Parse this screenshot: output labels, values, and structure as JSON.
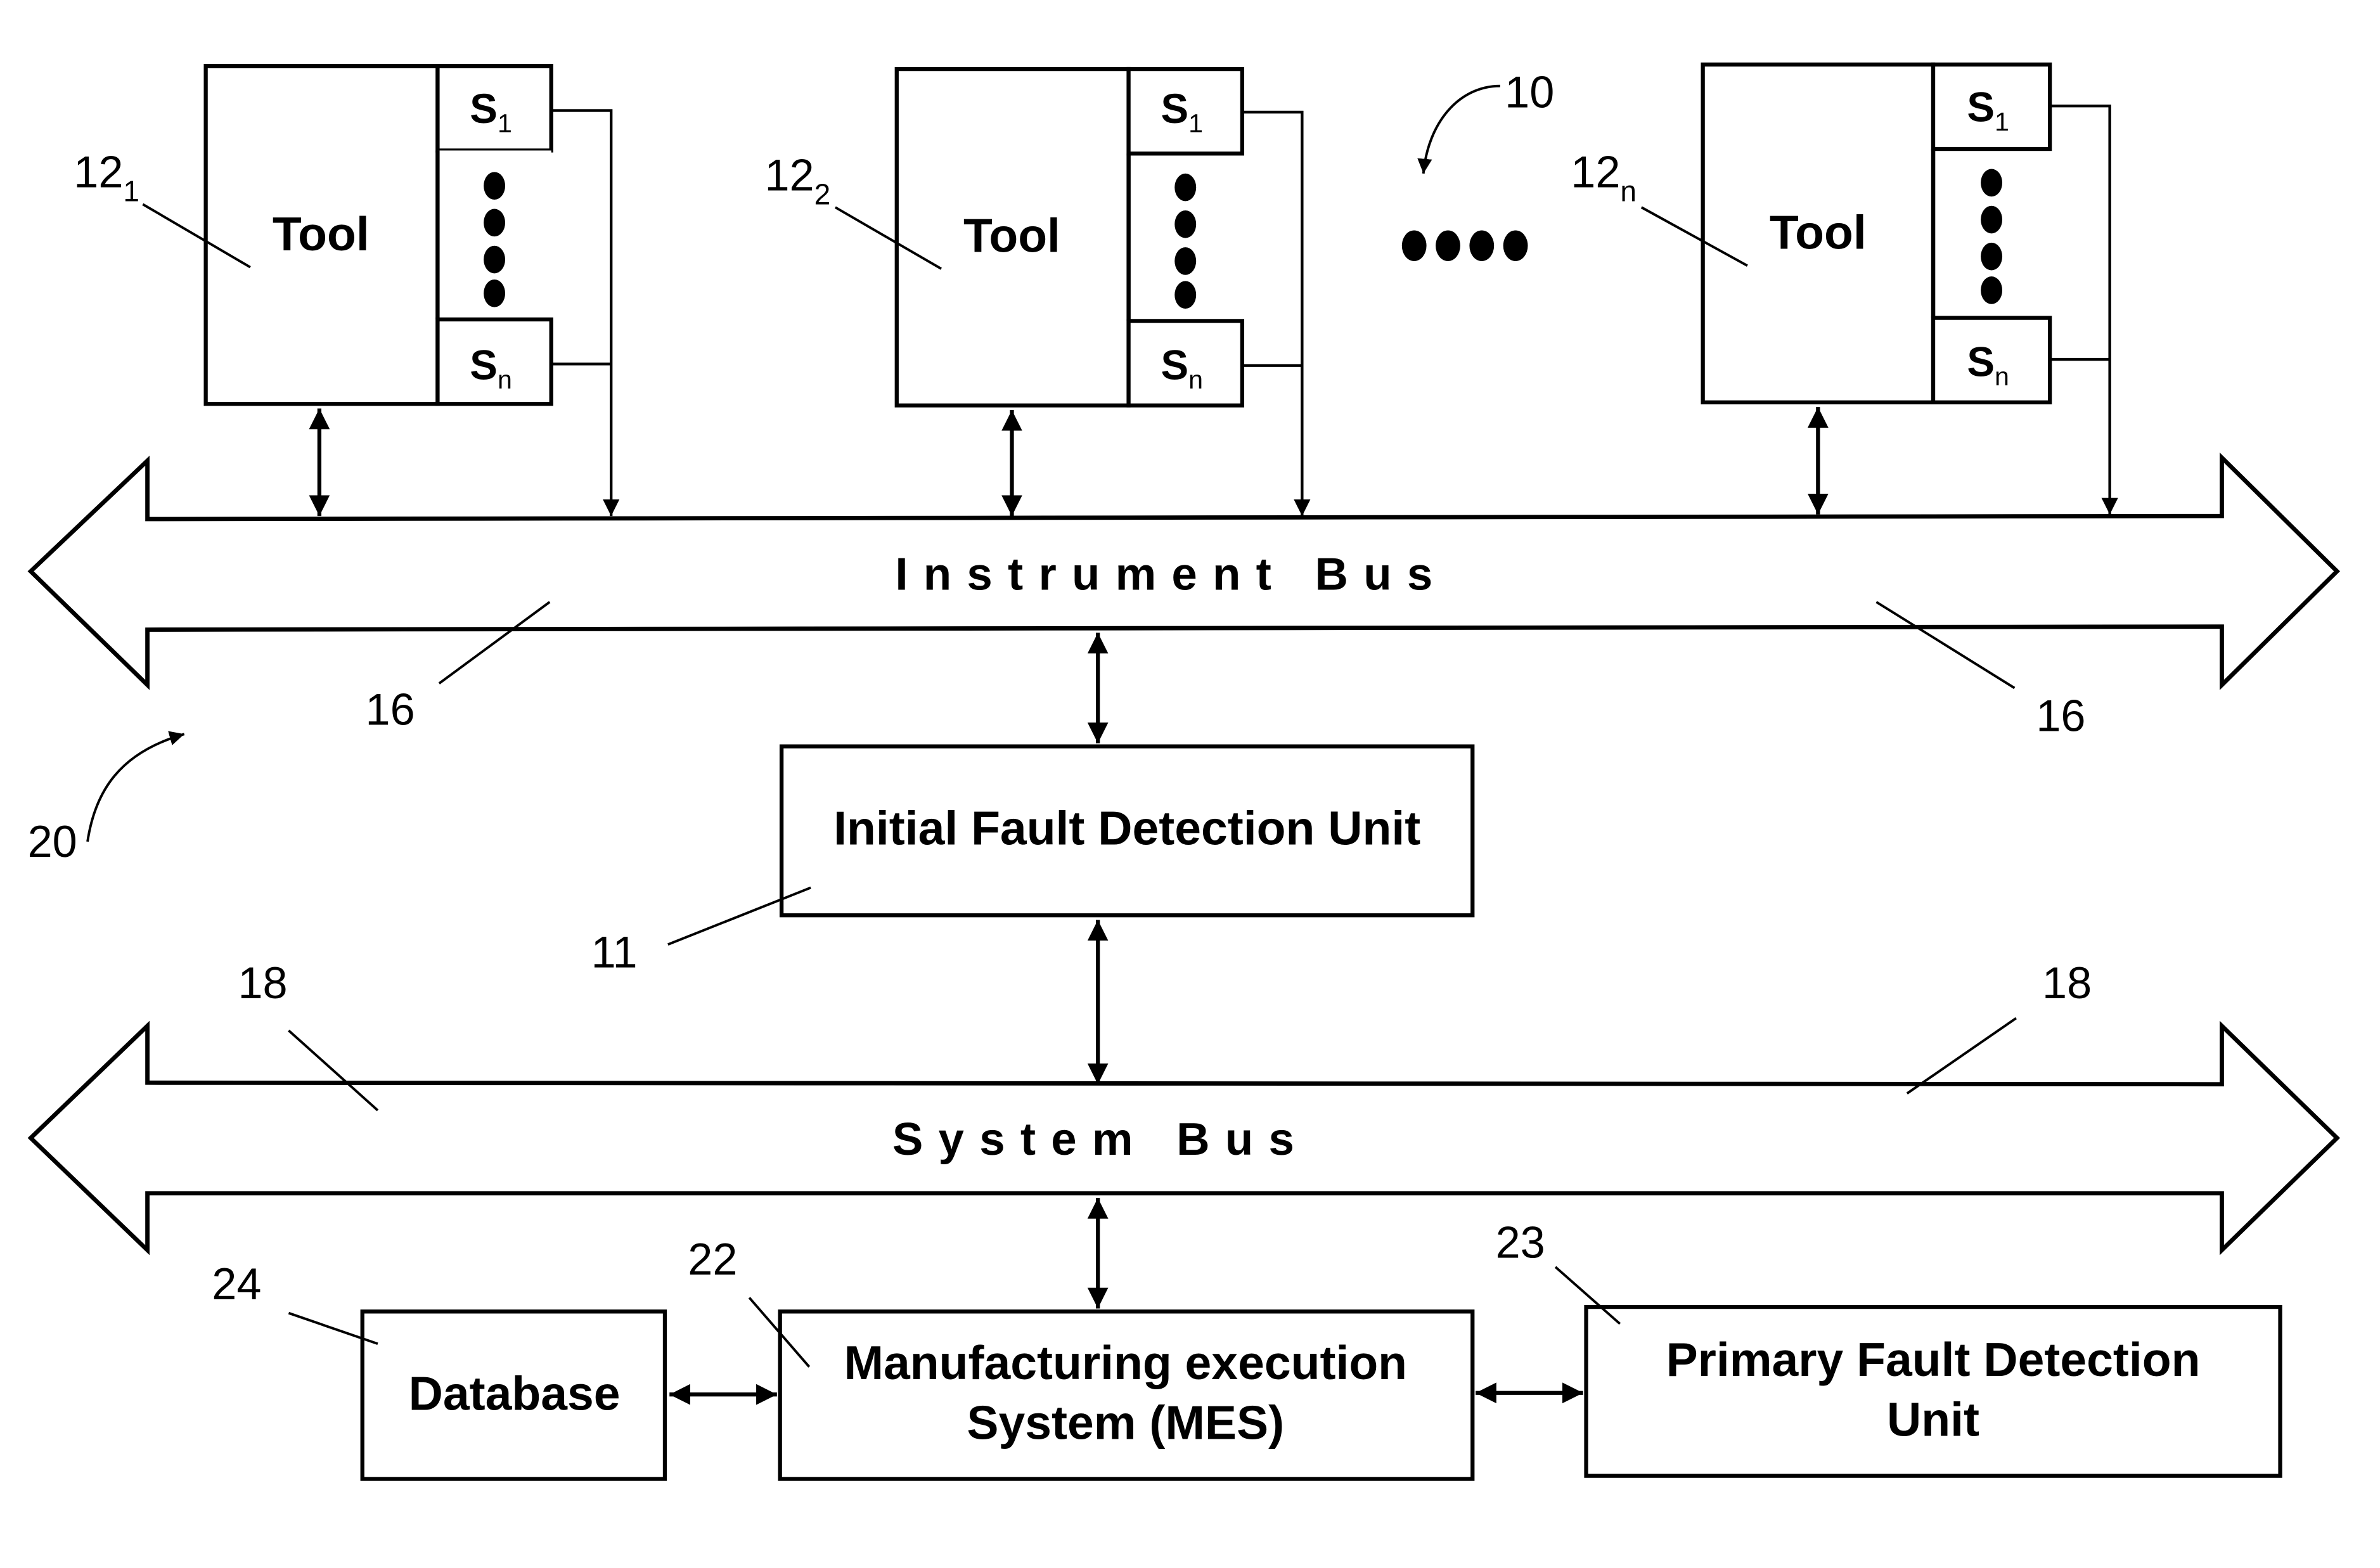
{
  "figure": {
    "system_ref": "10",
    "network_ref": "20"
  },
  "tools": [
    {
      "ref_main": "12",
      "ref_sub": "1",
      "label": "Tool",
      "sensor_first": {
        "main": "S",
        "sub": "1"
      },
      "sensor_last": {
        "main": "S",
        "sub": "n"
      }
    },
    {
      "ref_main": "12",
      "ref_sub": "2",
      "label": "Tool",
      "sensor_first": {
        "main": "S",
        "sub": "1"
      },
      "sensor_last": {
        "main": "S",
        "sub": "n"
      }
    },
    {
      "ref_main": "12",
      "ref_sub": "n",
      "label": "Tool",
      "sensor_first": {
        "main": "S",
        "sub": "1"
      },
      "sensor_last": {
        "main": "S",
        "sub": "n"
      }
    }
  ],
  "instrument_bus": {
    "label": "Instrument Bus",
    "ref_left": "16",
    "ref_right": "16"
  },
  "initial_fault_detection_unit": {
    "label": "Initial Fault Detection Unit",
    "ref": "11"
  },
  "system_bus": {
    "label": "System Bus",
    "ref_left": "18",
    "ref_right": "18"
  },
  "database": {
    "label": "Database",
    "ref": "24"
  },
  "mes": {
    "label_line1": "Manufacturing execution",
    "label_line2": "System (MES)",
    "ref": "22"
  },
  "primary_fault_detection_unit": {
    "label_line1": "Primary Fault Detection",
    "label_line2": "Unit",
    "ref": "23"
  }
}
